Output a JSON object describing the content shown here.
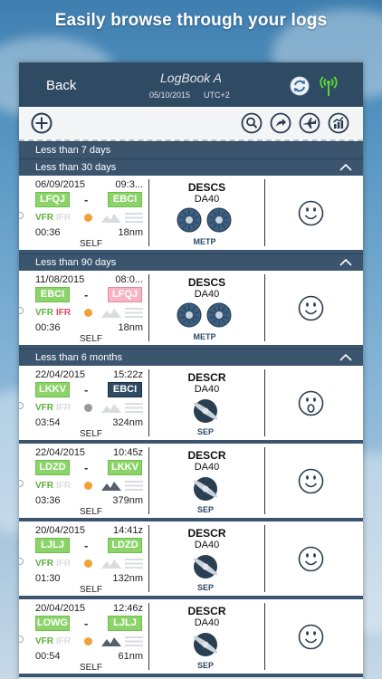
{
  "headline": "Easily browse through your logs",
  "navbar": {
    "back": "Back",
    "title": "LogBook A",
    "date": "05/10/2015",
    "timezone": "UTC+2"
  },
  "toolbar": {
    "icons": [
      "add-icon",
      "search-icon",
      "share-icon",
      "airplane-icon",
      "stats-icon"
    ]
  },
  "sections": [
    {
      "label": "Less than 7 days",
      "collapsible": false,
      "entries": []
    },
    {
      "label": "Less than 30 days",
      "collapsible": true,
      "entries": [
        {
          "date": "06/09/2015",
          "time": "09:3...",
          "dep": "LFQJ",
          "dep_style": "green",
          "arr": "EBCI",
          "arr_style": "green",
          "vfr": "VFR",
          "ifr": "IFR",
          "ifr_active": false,
          "day": "sun",
          "duration": "00:36",
          "distance": "18nm",
          "role": "SELF",
          "registration": "DESCS",
          "aircraft": "DA40",
          "engine": "METP",
          "mood": "smile"
        }
      ]
    },
    {
      "label": "Less than 90 days",
      "collapsible": true,
      "entries": [
        {
          "date": "11/08/2015",
          "time": "08:0...",
          "dep": "EBCI",
          "dep_style": "green",
          "arr": "LFQJ",
          "arr_style": "pink",
          "vfr": "VFR",
          "ifr": "IFR",
          "ifr_active": true,
          "day": "sun",
          "duration": "00:36",
          "distance": "18nm",
          "role": "SELF",
          "registration": "DESCS",
          "aircraft": "DA40",
          "engine": "METP",
          "mood": "smile"
        }
      ]
    },
    {
      "label": "Less than 6 months",
      "collapsible": true,
      "entries": [
        {
          "date": "22/04/2015",
          "time": "15:22z",
          "dep": "LKKV",
          "dep_style": "green",
          "arr": "EBCI",
          "arr_style": "navy",
          "vfr": "VFR",
          "ifr": "IFR",
          "ifr_active": false,
          "day": "moon",
          "duration": "03:54",
          "distance": "324nm",
          "role": "SELF",
          "registration": "DESCR",
          "aircraft": "DA40",
          "engine": "SEP",
          "mood": "surprised"
        },
        {
          "date": "22/04/2015",
          "time": "10:45z",
          "dep": "LDZD",
          "dep_style": "green",
          "arr": "LKKV",
          "arr_style": "green",
          "vfr": "VFR",
          "ifr": "IFR",
          "ifr_active": false,
          "day": "sun",
          "duration": "03:36",
          "distance": "379nm",
          "role": "SELF",
          "registration": "DESCR",
          "aircraft": "DA40",
          "engine": "SEP",
          "mood": "smile"
        },
        {
          "date": "20/04/2015",
          "time": "14:41z",
          "dep": "LJLJ",
          "dep_style": "green",
          "arr": "LDZD",
          "arr_style": "green",
          "vfr": "VFR",
          "ifr": "IFR",
          "ifr_active": false,
          "day": "sun",
          "duration": "01:30",
          "distance": "132nm",
          "role": "SELF",
          "registration": "DESCR",
          "aircraft": "DA40",
          "engine": "SEP",
          "mood": "smile"
        },
        {
          "date": "20/04/2015",
          "time": "12:46z",
          "dep": "LOWG",
          "dep_style": "green",
          "arr": "LJLJ",
          "arr_style": "green",
          "vfr": "VFR",
          "ifr": "IFR",
          "ifr_active": false,
          "day": "sun",
          "duration": "00:54",
          "distance": "61nm",
          "role": "SELF",
          "registration": "DESCR",
          "aircraft": "DA40",
          "engine": "SEP",
          "mood": "smile"
        }
      ]
    }
  ]
}
